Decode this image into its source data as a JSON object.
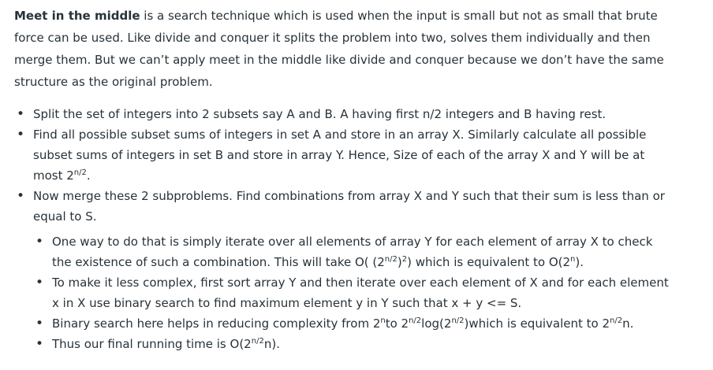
{
  "intro": {
    "bold": "Meet in the middle",
    "rest": " is a search technique which is used when the input is small but not as small that brute force can be used. Like divide and conquer it splits the problem into two, solves them individually and then merge them. But we can’t apply meet in the middle like divide and conquer because we don’t have the same structure as the original problem."
  },
  "steps": {
    "s1": "Split the set of integers into 2 subsets say A and B. A having first n/2 integers and B having rest.",
    "s2_text": "Find all possible subset sums of integers in set A and store in an array X. Similarly calculate all possible subset sums of integers in set B and store in array Y. Hence, Size of each of the array X and Y will be at most 2",
    "s2_sup": "n/2",
    "s2_end": ".",
    "s3": "Now merge these 2 subproblems. Find combinations from array X and Y such that their sum is less than or equal to S."
  },
  "sub": {
    "a_text": "One way to do that is simply iterate over all elements of array Y for each element of array X to check the existence of such a combination. This will take O( (2",
    "a_sup1": "n/2",
    "a_mid": ")",
    "a_sup2": "2",
    "a_mid2": ") which is equivalent to O(2",
    "a_sup3": "n",
    "a_end": ").",
    "b": "To make it less complex, first sort array Y and then iterate over each element of X and for each element x in X use binary search to find maximum element y in Y such that x + y <= S.",
    "c_text": "Binary search here helps in reducing complexity from 2",
    "c_sup1": "n",
    "c_mid1": "to 2",
    "c_sup2": "n/2",
    "c_mid2": "log(2",
    "c_sup3": "n/2",
    "c_mid3": ")which is equivalent to 2",
    "c_sup4": "n/2",
    "c_end": "n.",
    "d_text": "Thus our final running time is O(2",
    "d_sup": "n/2",
    "d_end": "n)."
  }
}
